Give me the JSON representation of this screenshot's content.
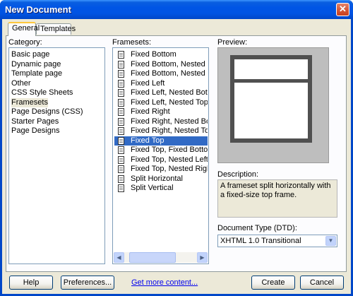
{
  "window": {
    "title": "New Document",
    "close_glyph": "✕"
  },
  "tabs": [
    {
      "label": "General"
    },
    {
      "label": "Templates"
    }
  ],
  "category": {
    "label": "Category:",
    "items": [
      {
        "label": "Basic page"
      },
      {
        "label": "Dynamic page"
      },
      {
        "label": "Template page"
      },
      {
        "label": "Other"
      },
      {
        "label": "CSS Style Sheets"
      },
      {
        "label": "Framesets"
      },
      {
        "label": "Page Designs (CSS)"
      },
      {
        "label": "Starter Pages"
      },
      {
        "label": "Page Designs"
      }
    ],
    "selected": "Framesets"
  },
  "framesets": {
    "label": "Framesets:",
    "items": [
      {
        "label": "Fixed Bottom"
      },
      {
        "label": "Fixed Bottom, Nested Left"
      },
      {
        "label": "Fixed Bottom, Nested Right"
      },
      {
        "label": "Fixed Left"
      },
      {
        "label": "Fixed Left, Nested Bottom"
      },
      {
        "label": "Fixed Left, Nested Top"
      },
      {
        "label": "Fixed Right"
      },
      {
        "label": "Fixed Right, Nested Bottom"
      },
      {
        "label": "Fixed Right, Nested Top"
      },
      {
        "label": "Fixed Top"
      },
      {
        "label": "Fixed Top, Fixed Bottom"
      },
      {
        "label": "Fixed Top, Nested Left"
      },
      {
        "label": "Fixed Top, Nested Right"
      },
      {
        "label": "Split Horizontal"
      },
      {
        "label": "Split Vertical"
      }
    ],
    "selected": "Fixed Top",
    "scroll_left": "◀",
    "scroll_right": "▶"
  },
  "preview": {
    "label": "Preview:"
  },
  "description": {
    "label": "Description:",
    "text": "A frameset split horizontally with a fixed-size top frame."
  },
  "doctype": {
    "label": "Document Type (DTD):",
    "value": "XHTML 1.0 Transitional",
    "arrow": "▼"
  },
  "buttons": {
    "help": "Help",
    "preferences": "Preferences...",
    "get_more": "Get more content...",
    "create": "Create",
    "cancel": "Cancel"
  },
  "colors": {
    "title_bar": "#0054e3",
    "selection": "#316ac5",
    "dialog_bg": "#ece9d8"
  }
}
